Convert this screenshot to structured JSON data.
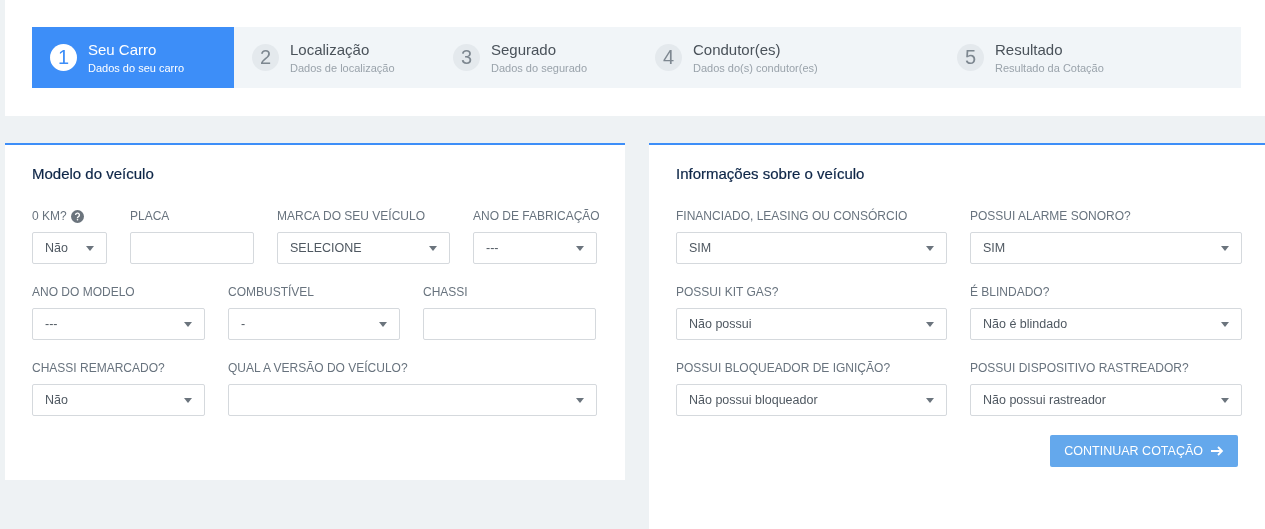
{
  "steps": [
    {
      "number": "1",
      "title": "Seu Carro",
      "subtitle": "Dados do seu carro",
      "selected": true
    },
    {
      "number": "2",
      "title": "Localização",
      "subtitle": "Dados de localização",
      "selected": false
    },
    {
      "number": "3",
      "title": "Segurado",
      "subtitle": "Dados do segurado",
      "selected": false
    },
    {
      "number": "4",
      "title": "Condutor(es)",
      "subtitle": "Dados do(s) condutor(es)",
      "selected": false
    },
    {
      "number": "5",
      "title": "Resultado",
      "subtitle": "Resultado da Cotação",
      "selected": false
    }
  ],
  "vehicle_model": {
    "title": "Modelo do veículo",
    "rows": [
      [
        {
          "label": "0 KM?",
          "help": true,
          "kind": "select",
          "value": "Não"
        },
        {
          "label": "PLACA",
          "help": false,
          "kind": "text"
        },
        {
          "label": "MARCA DO SEU VEÍCULO",
          "help": false,
          "kind": "select",
          "value": "SELECIONE"
        },
        {
          "label": "ANO DE FABRICAÇÃO",
          "help": false,
          "kind": "select",
          "value": "---"
        }
      ],
      [
        {
          "label": "ANO DO MODELO",
          "help": false,
          "kind": "select",
          "value": "---"
        },
        {
          "label": "COMBUSTÍVEL",
          "help": false,
          "kind": "select",
          "value": "-"
        },
        {
          "label": "CHASSI",
          "help": false,
          "kind": "text"
        }
      ],
      [
        {
          "label": "CHASSI REMARCADO?",
          "help": false,
          "kind": "select",
          "value": "Não"
        },
        {
          "label": "QUAL A VERSÃO DO VEÍCULO?",
          "help": false,
          "kind": "select"
        }
      ]
    ]
  },
  "vehicle_info": {
    "title": "Informações sobre o veículo",
    "rows": [
      [
        {
          "label": "FINANCIADO, LEASING OU CONSÓRCIO",
          "help": false,
          "kind": "select",
          "value": "SIM"
        },
        {
          "label": "POSSUI ALARME SONORO?",
          "help": false,
          "kind": "select",
          "value": "SIM"
        }
      ],
      [
        {
          "label": "POSSUI KIT GAS?",
          "help": false,
          "kind": "select",
          "value": "Não possui"
        },
        {
          "label": "É BLINDADO?",
          "help": false,
          "kind": "select",
          "value": "Não é blindado"
        }
      ],
      [
        {
          "label": "POSSUI BLOQUEADOR DE IGNIÇÃO?",
          "help": false,
          "kind": "select",
          "value": "Não possui bloqueador"
        },
        {
          "label": "POSSUI DISPOSITIVO RASTREADOR?",
          "help": false,
          "kind": "select",
          "value": "Não possui rastreador"
        }
      ]
    ],
    "button": "CONTINUAR COTAÇÃO"
  }
}
